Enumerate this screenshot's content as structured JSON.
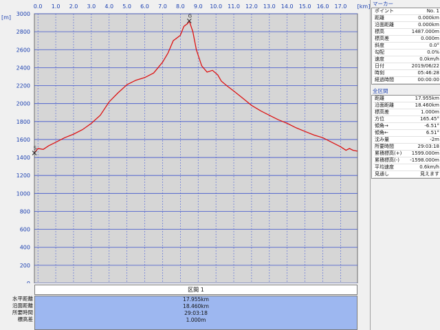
{
  "chart_data": {
    "type": "line",
    "x_unit": "[km]",
    "y_unit": "[m]",
    "x_ticks": [
      "0.0",
      "1.0",
      "2.0",
      "3.0",
      "4.0",
      "5.0",
      "6.0",
      "7.0",
      "8.0",
      "9.0",
      "10.0",
      "11.0",
      "12.0",
      "13.0",
      "14.0",
      "15.0",
      "16.0",
      "17.0"
    ],
    "y_ticks": [
      "0",
      "200",
      "400",
      "600",
      "800",
      "1000",
      "1200",
      "1400",
      "1600",
      "1800",
      "2000",
      "2200",
      "2400",
      "2600",
      "2800",
      "3000"
    ],
    "xlim": [
      -0.2,
      17.95
    ],
    "ylim": [
      0,
      3000
    ],
    "grid": true,
    "line_color": "#dd1111",
    "series": [
      {
        "x": [
          -0.2,
          0.0,
          0.3,
          0.6,
          1.0,
          1.5,
          2.0,
          2.5,
          3.0,
          3.5,
          4.0,
          4.5,
          5.0,
          5.5,
          6.0,
          6.5,
          7.0,
          7.3,
          7.6,
          7.8,
          8.0,
          8.2,
          8.4,
          8.5,
          8.7,
          8.9,
          9.2,
          9.5,
          9.8,
          10.1,
          10.3,
          10.6,
          11.0,
          11.5,
          12.0,
          12.5,
          13.0,
          13.5,
          14.0,
          14.5,
          15.0,
          15.5,
          16.0,
          16.5,
          17.0,
          17.3,
          17.5,
          17.7,
          17.95
        ],
        "y": [
          1450,
          1500,
          1490,
          1530,
          1570,
          1620,
          1660,
          1710,
          1780,
          1870,
          2020,
          2120,
          2210,
          2260,
          2290,
          2340,
          2460,
          2560,
          2700,
          2730,
          2760,
          2860,
          2890,
          2920,
          2800,
          2600,
          2420,
          2350,
          2370,
          2320,
          2250,
          2200,
          2140,
          2060,
          1980,
          1920,
          1870,
          1820,
          1780,
          1730,
          1690,
          1650,
          1620,
          1570,
          1520,
          1480,
          1500,
          1480,
          1470
        ]
      }
    ],
    "markers": [
      {
        "x": -0.2,
        "y": 1450,
        "label": "S"
      },
      {
        "x": 8.5,
        "y": 2920,
        "label": "G"
      }
    ]
  },
  "bottom": {
    "section_label": "区間 1",
    "labels": [
      "水平距離",
      "沿面距離",
      "所要時間",
      "標高差"
    ],
    "values": [
      "17.955km",
      "18.460km",
      "29:03:18",
      "1.000m"
    ]
  },
  "side": {
    "marker_title": "マーカー",
    "marker_rows": [
      {
        "label": "ポイント",
        "value": "No. 1"
      },
      {
        "label": "距離",
        "value": "0.000km"
      },
      {
        "label": "沿面距離",
        "value": "0.000km"
      },
      {
        "label": "標高",
        "value": "1487.000m"
      },
      {
        "label": "標高差",
        "value": "0.000m"
      },
      {
        "label": "斜度",
        "value": "0.0°"
      },
      {
        "label": "勾配",
        "value": "0.0%"
      },
      {
        "label": "速度",
        "value": "0.0km/h"
      },
      {
        "label": "日付",
        "value": "2019/06/22"
      },
      {
        "label": "時刻",
        "value": "05:46:28"
      },
      {
        "label": "経過時間",
        "value": "00:00:00"
      }
    ],
    "section_title": "全区間",
    "section_rows": [
      {
        "label": "距離",
        "value": "17.955km"
      },
      {
        "label": "沿面距離",
        "value": "18.460km"
      },
      {
        "label": "標高差",
        "value": "1.000m"
      },
      {
        "label": "方位",
        "value": "165.45°"
      },
      {
        "label": "傾角→",
        "value": "-6.51°"
      },
      {
        "label": "傾角←",
        "value": "6.51°"
      },
      {
        "label": "沈み量",
        "value": "-2m"
      },
      {
        "label": "所要時間",
        "value": "29:03:18"
      },
      {
        "label": "累積標高(+)",
        "value": "1599.000m"
      },
      {
        "label": "累積標高(-)",
        "value": "-1598.000m"
      },
      {
        "label": "平均速度",
        "value": "0.6km/h"
      },
      {
        "label": "見通し",
        "value": "見えます"
      }
    ]
  }
}
